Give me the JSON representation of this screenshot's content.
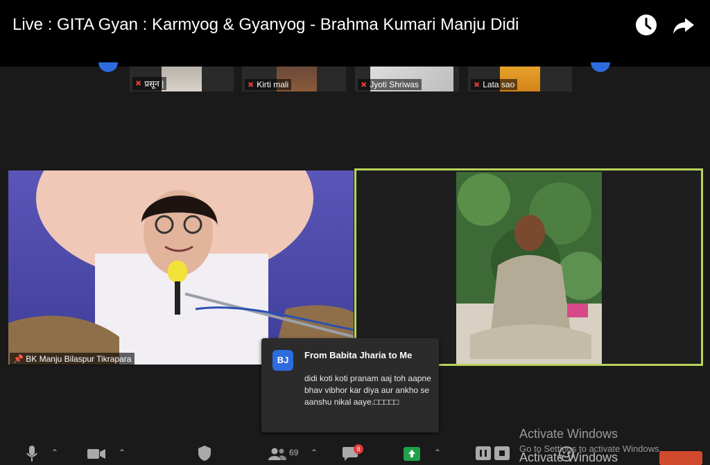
{
  "video": {
    "title": "Live : GITA Gyan : Karmyog & Gyanyog - Brahma Kumari Manju Didi"
  },
  "icons": {
    "watch_later": "clock-icon",
    "share": "share-arrow-icon"
  },
  "participants": [
    {
      "name": "प्रसून |"
    },
    {
      "name": "Kirti mali"
    },
    {
      "name": "Jyoti Shriwas"
    },
    {
      "name": "Lata sao"
    }
  ],
  "speaker": {
    "name": "BK Manju Bilaspur Tikrapara"
  },
  "chat": {
    "avatar_initials": "BJ",
    "from": "From Babita Jharia to Me",
    "message": "didi koti koti pranam aaj toh aapne bhav vibhor kar diya aur ankho se aanshu nikal aaye.□□□□□"
  },
  "toolbar": {
    "participants_count": "69",
    "chat_badge": "8"
  },
  "watermark": {
    "line1": "Activate Windows",
    "line2": "Go to Settings to activate Windows.",
    "line3": "Activate Windows"
  },
  "colors": {
    "active_border": "#b9d35c",
    "accent_blue": "#2d6cdf",
    "mute_red": "#e03b3b",
    "share_green": "#1fa24a"
  }
}
